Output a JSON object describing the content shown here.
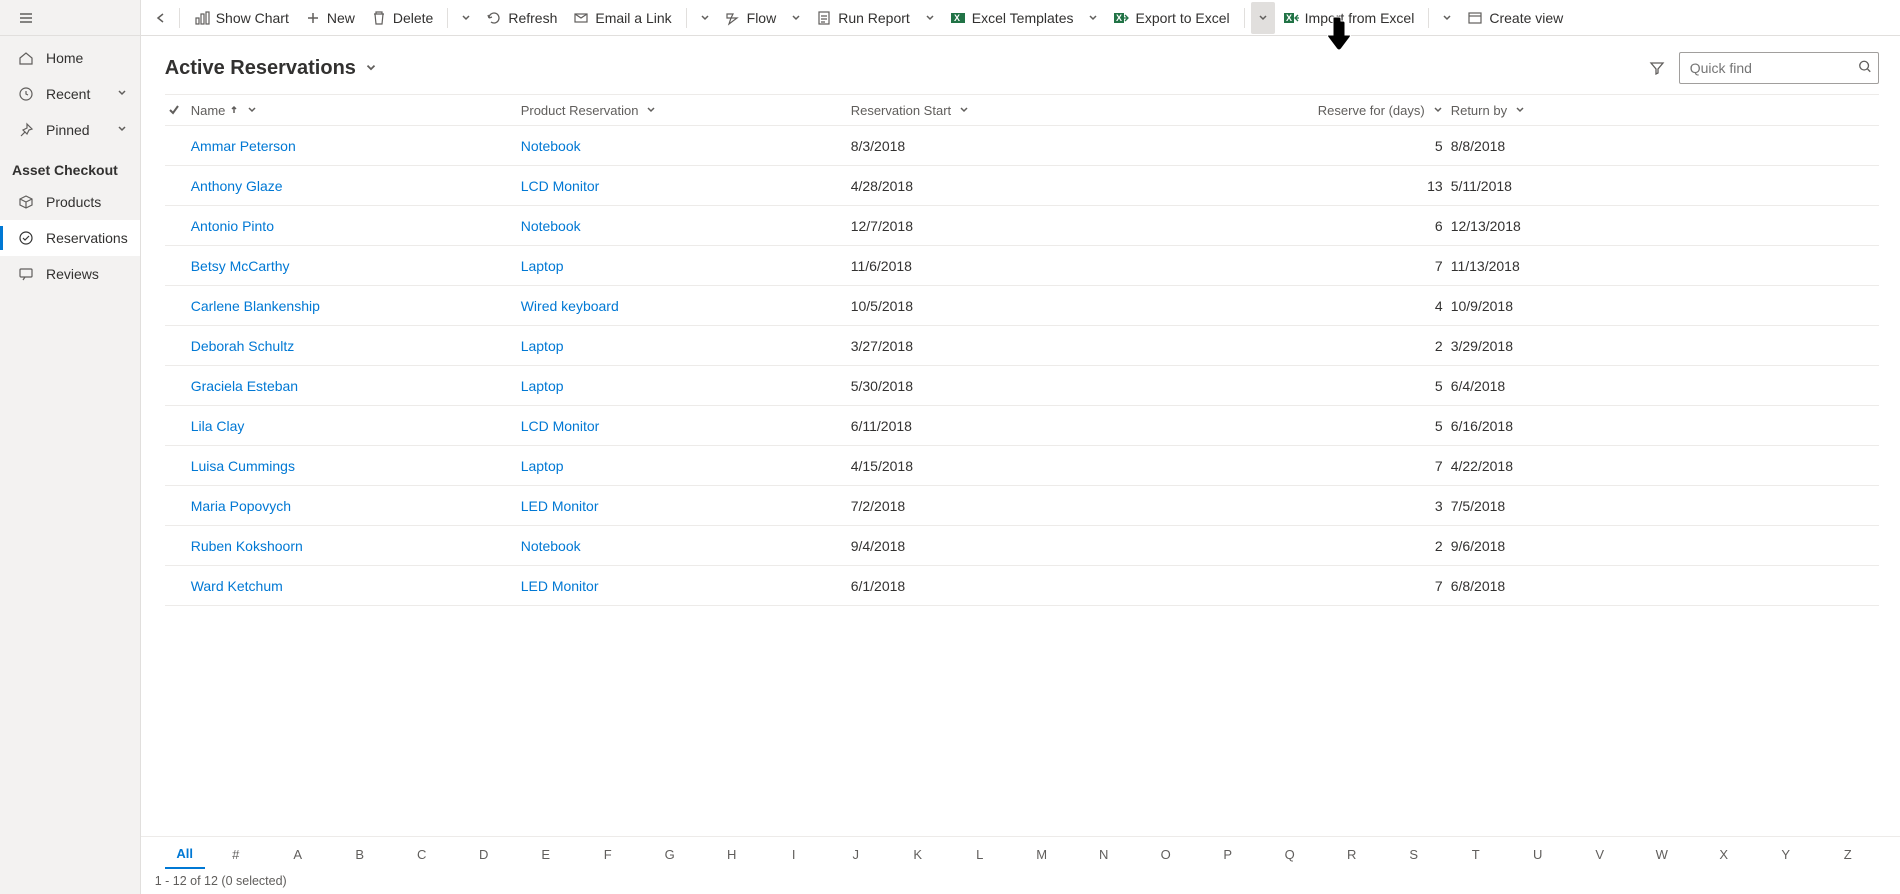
{
  "sidebar": {
    "home": "Home",
    "recent": "Recent",
    "pinned": "Pinned",
    "section": "Asset Checkout",
    "products": "Products",
    "reservations": "Reservations",
    "reviews": "Reviews"
  },
  "commands": {
    "show_chart": "Show Chart",
    "new": "New",
    "delete": "Delete",
    "refresh": "Refresh",
    "email_link": "Email a Link",
    "flow": "Flow",
    "run_report": "Run Report",
    "excel_templates": "Excel Templates",
    "export_excel": "Export to Excel",
    "import_excel": "Import from Excel",
    "create_view": "Create view"
  },
  "page": {
    "title": "Active Reservations",
    "search_placeholder": "Quick find"
  },
  "columns": {
    "name": "Name",
    "product": "Product Reservation",
    "start": "Reservation Start",
    "days": "Reserve for (days)",
    "return": "Return by"
  },
  "rows": [
    {
      "name": "Ammar Peterson",
      "product": "Notebook",
      "start": "8/3/2018",
      "days": "5",
      "return": "8/8/2018"
    },
    {
      "name": "Anthony Glaze",
      "product": "LCD Monitor",
      "start": "4/28/2018",
      "days": "13",
      "return": "5/11/2018"
    },
    {
      "name": "Antonio Pinto",
      "product": "Notebook",
      "start": "12/7/2018",
      "days": "6",
      "return": "12/13/2018"
    },
    {
      "name": "Betsy McCarthy",
      "product": "Laptop",
      "start": "11/6/2018",
      "days": "7",
      "return": "11/13/2018"
    },
    {
      "name": "Carlene Blankenship",
      "product": "Wired keyboard",
      "start": "10/5/2018",
      "days": "4",
      "return": "10/9/2018"
    },
    {
      "name": "Deborah Schultz",
      "product": "Laptop",
      "start": "3/27/2018",
      "days": "2",
      "return": "3/29/2018"
    },
    {
      "name": "Graciela Esteban",
      "product": "Laptop",
      "start": "5/30/2018",
      "days": "5",
      "return": "6/4/2018"
    },
    {
      "name": "Lila Clay",
      "product": "LCD Monitor",
      "start": "6/11/2018",
      "days": "5",
      "return": "6/16/2018"
    },
    {
      "name": "Luisa Cummings",
      "product": "Laptop",
      "start": "4/15/2018",
      "days": "7",
      "return": "4/22/2018"
    },
    {
      "name": "Maria Popovych",
      "product": "LED Monitor",
      "start": "7/2/2018",
      "days": "3",
      "return": "7/5/2018"
    },
    {
      "name": "Ruben Kokshoorn",
      "product": "Notebook",
      "start": "9/4/2018",
      "days": "2",
      "return": "9/6/2018"
    },
    {
      "name": "Ward Ketchum",
      "product": "LED Monitor",
      "start": "6/1/2018",
      "days": "7",
      "return": "6/8/2018"
    }
  ],
  "alpha": [
    "All",
    "#",
    "A",
    "B",
    "C",
    "D",
    "E",
    "F",
    "G",
    "H",
    "I",
    "J",
    "K",
    "L",
    "M",
    "N",
    "O",
    "P",
    "Q",
    "R",
    "S",
    "T",
    "U",
    "V",
    "W",
    "X",
    "Y",
    "Z"
  ],
  "status": "1 - 12 of 12 (0 selected)"
}
